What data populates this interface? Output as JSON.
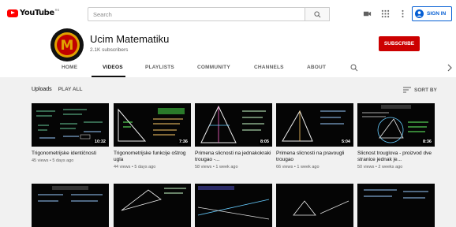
{
  "topbar": {
    "logo_text": "YouTube",
    "logo_sup": "RS",
    "search_placeholder": "Search",
    "signin_label": "SIGN IN"
  },
  "channel": {
    "name": "Ucim Matematiku",
    "subscribers": "2.1K subscribers",
    "subscribe_label": "SUBSCRIBE",
    "avatar_letter": "M"
  },
  "tabs": [
    {
      "label": "HOME"
    },
    {
      "label": "VIDEOS"
    },
    {
      "label": "PLAYLISTS"
    },
    {
      "label": "COMMUNITY"
    },
    {
      "label": "CHANNELS"
    },
    {
      "label": "ABOUT"
    }
  ],
  "active_tab": "VIDEOS",
  "section": {
    "title": "Uploads",
    "play_all": "PLAY ALL",
    "sort_by": "SORT BY"
  },
  "videos": [
    {
      "title": "Trigonometrijske identičnosti",
      "meta": "45 views • 5 days ago",
      "duration": "10:32"
    },
    {
      "title": "Trigonometrijske funkcije oštrog ugla",
      "meta": "44 views • 5 days ago",
      "duration": "7:36"
    },
    {
      "title": "Primena slicnosti na jednakokraki trougao -...",
      "meta": "58 views • 1 week ago",
      "duration": "8:05"
    },
    {
      "title": "Primena slicnosti na pravougli trougao",
      "meta": "66 views • 1 week ago",
      "duration": "5:04"
    },
    {
      "title": "Slicnost trouglova - proizvod dve stranice jednak je...",
      "meta": "50 views • 2 weeks ago",
      "duration": "8:36"
    }
  ],
  "colors": {
    "brand_red": "#ff0000",
    "subscribe_red": "#cc0000",
    "link_blue": "#065fd4"
  }
}
